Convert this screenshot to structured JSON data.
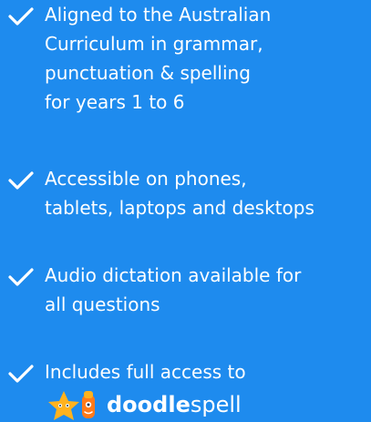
{
  "features": [
    {
      "icon": "check-icon",
      "lines": [
        "Aligned to the Australian",
        "Curriculum in grammar,",
        "punctuation & spelling",
        "for years 1 to 6"
      ]
    },
    {
      "icon": "check-icon",
      "lines": [
        "Accessible on phones,",
        "tablets, laptops and desktops"
      ]
    },
    {
      "icon": "check-icon",
      "lines": [
        "Audio dictation available for",
        "all questions"
      ]
    },
    {
      "icon": "check-icon",
      "lines": [
        "Includes full access to"
      ]
    }
  ],
  "brand": {
    "name_bold": "doodle",
    "name_regular": "spell",
    "logo_icon": "doodlespell-mascot-logo"
  },
  "colors": {
    "background": "#1e8bee",
    "text": "#ffffff",
    "star": "#ffb21e",
    "mascot": "#ff7a1a"
  }
}
